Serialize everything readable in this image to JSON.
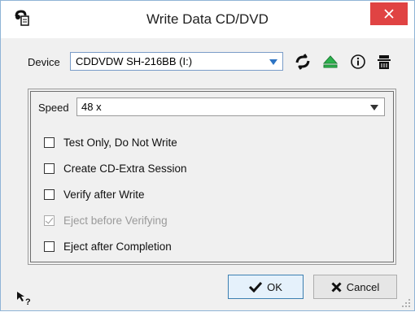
{
  "window": {
    "title": "Write Data CD/DVD"
  },
  "device": {
    "label": "Device",
    "value": "CDDVDW SH-216BB (I:)"
  },
  "toolbar_icons": [
    "refresh-icon",
    "eject-icon",
    "info-icon",
    "erase-disc-icon"
  ],
  "speed": {
    "label": "Speed",
    "value": "48 x"
  },
  "options": [
    {
      "label": "Test Only, Do Not Write",
      "checked": false,
      "enabled": true
    },
    {
      "label": "Create CD-Extra Session",
      "checked": false,
      "enabled": true
    },
    {
      "label": "Verify after Write",
      "checked": false,
      "enabled": true
    },
    {
      "label": "Eject before Verifying",
      "checked": true,
      "enabled": false
    },
    {
      "label": "Eject after Completion",
      "checked": false,
      "enabled": true
    }
  ],
  "buttons": {
    "ok": "OK",
    "cancel": "Cancel"
  },
  "colors": {
    "close_red": "#e04343",
    "eject_green": "#2bb24c",
    "accent_blue": "#2d74c4"
  }
}
